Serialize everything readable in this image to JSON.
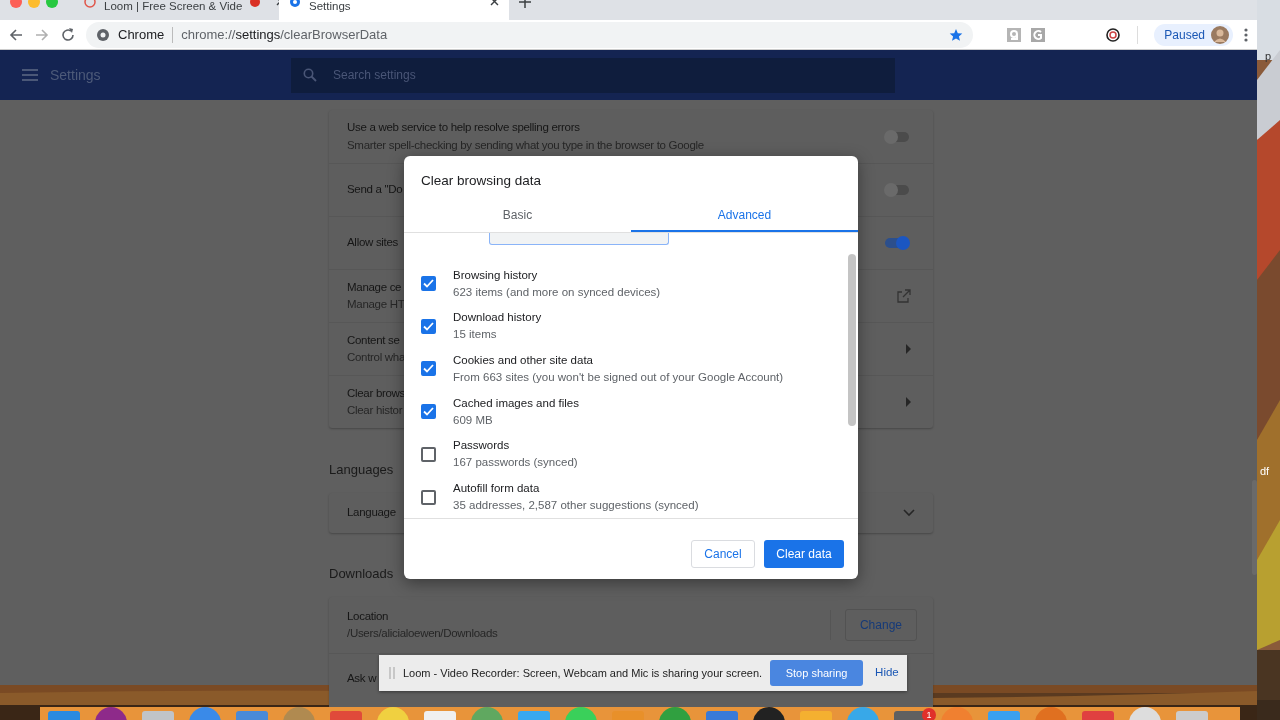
{
  "browser_tabs": [
    {
      "title": "Loom | Free Screen & Vide",
      "selected": false,
      "recording": true
    },
    {
      "title": "Settings",
      "selected": true
    }
  ],
  "address_bar": {
    "site_label": "Chrome",
    "url_scheme": "chrome://",
    "url_host": "settings",
    "url_path": "/clearBrowserData",
    "bookmarked": true
  },
  "profile": {
    "label": "Paused"
  },
  "settings_header": {
    "title": "Settings",
    "search_placeholder": "Search settings"
  },
  "privacy_rows": [
    {
      "kind": "toggle",
      "title": "Use a web service to help resolve spelling errors",
      "subtitle": "Smarter spell-checking by sending what you type in the browser to Google",
      "on": false
    },
    {
      "kind": "toggle",
      "title": "Send a \"Do",
      "on": false
    },
    {
      "kind": "toggle",
      "title": "Allow sites",
      "on": true
    },
    {
      "kind": "external",
      "title": "Manage ce",
      "subtitle": "Manage HT"
    },
    {
      "kind": "arrow",
      "title": "Content se",
      "subtitle": "Control wha"
    },
    {
      "kind": "arrow",
      "title": "Clear brows",
      "subtitle": "Clear histor"
    }
  ],
  "languages": {
    "heading": "Languages",
    "row": "Language"
  },
  "downloads": {
    "heading": "Downloads",
    "location_label": "Location",
    "location_path": "/Users/alicialoewen/Downloads",
    "change_button": "Change",
    "next_row": "Ask w"
  },
  "dialog": {
    "title": "Clear browsing data",
    "tabs": [
      {
        "label": "Basic",
        "selected": false
      },
      {
        "label": "Advanced",
        "selected": true
      }
    ],
    "items": [
      {
        "title": "Browsing history",
        "subtitle": "623 items (and more on synced devices)",
        "checked": true
      },
      {
        "title": "Download history",
        "subtitle": "15 items",
        "checked": true
      },
      {
        "title": "Cookies and other site data",
        "subtitle": "From 663 sites (you won't be signed out of your Google Account)",
        "checked": true
      },
      {
        "title": "Cached images and files",
        "subtitle": "609 MB",
        "checked": true
      },
      {
        "title": "Passwords",
        "subtitle": "167 passwords (synced)",
        "checked": false
      },
      {
        "title": "Autofill form data",
        "subtitle": "35 addresses, 2,587 other suggestions (synced)",
        "checked": false
      }
    ],
    "cancel": "Cancel",
    "confirm": "Clear data"
  },
  "share_bar": {
    "message": "Loom - Video Recorder: Screen, Webcam and Mic is sharing your screen.",
    "stop": "Stop sharing",
    "hide": "Hide"
  },
  "desktop_labels": [
    "p",
    "df"
  ],
  "dock_badge": "1"
}
